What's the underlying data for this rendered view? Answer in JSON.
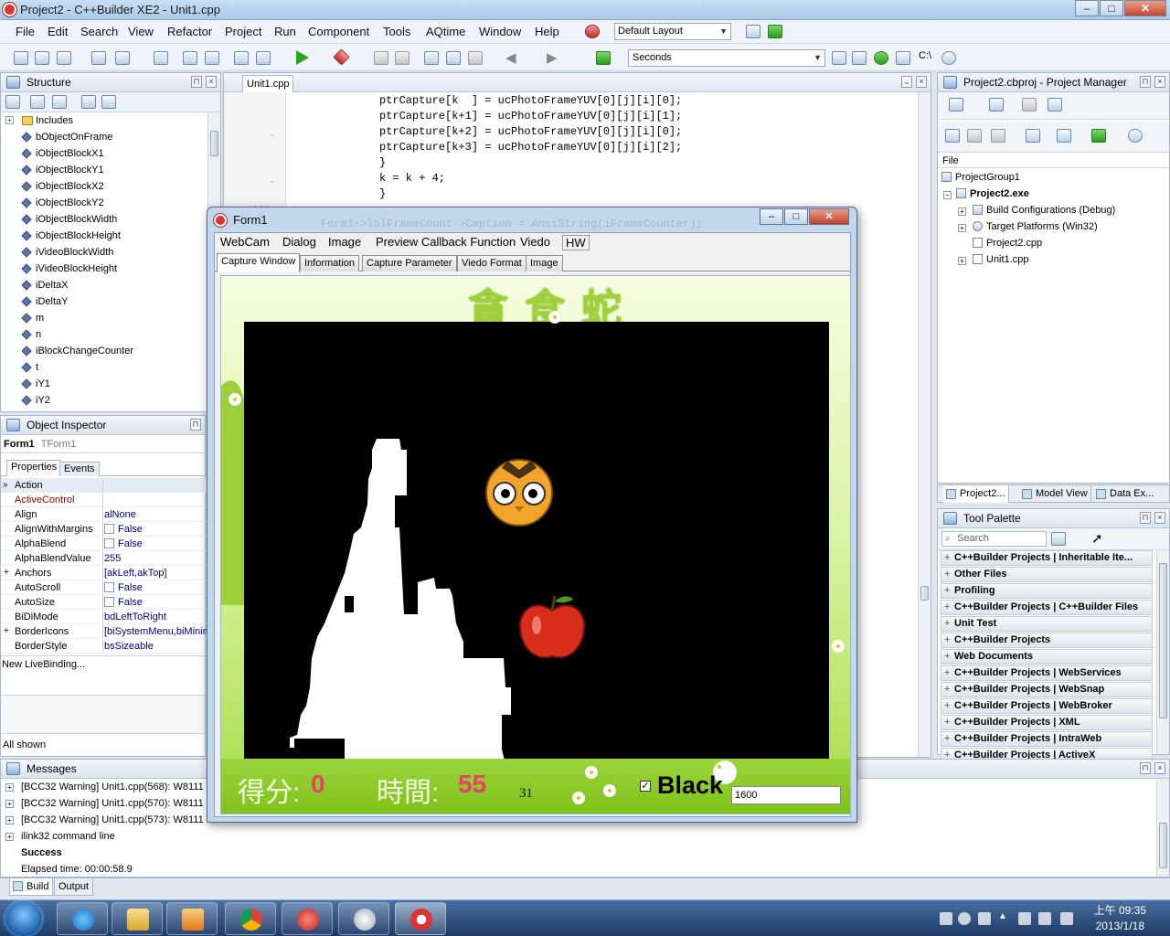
{
  "window": {
    "title": "Project2 - C++Builder XE2 - Unit1.cpp",
    "buttons": {
      "minimize": "–",
      "maximize": "□",
      "close": "✕"
    }
  },
  "menu": [
    "File",
    "Edit",
    "Search",
    "View",
    "Refactor",
    "Project",
    "Run",
    "Component",
    "Tools",
    "AQtime",
    "Window",
    "Help"
  ],
  "layout_select": "Default Layout",
  "toolbar": {
    "seconds_select": "Seconds",
    "path_label": "C:\\"
  },
  "structure": {
    "title": "Structure",
    "folder": "Includes",
    "items": [
      "bObjectOnFrame",
      "iObjectBlockX1",
      "iObjectBlockY1",
      "iObjectBlockX2",
      "iObjectBlockY2",
      "iObjectBlockWidth",
      "iObjectBlockHeight",
      "iVideoBlockWidth",
      "iVideoBlockHeight",
      "iDeltaX",
      "iDeltaY",
      "m",
      "n",
      "iBlockChangeCounter",
      "t",
      "iY1",
      "iY2"
    ]
  },
  "inspector": {
    "title": "Object Inspector",
    "object_name": "Form1",
    "object_type": "TForm1",
    "tabs": [
      "Properties",
      "Events"
    ],
    "properties": [
      {
        "name": "Action",
        "value": ""
      },
      {
        "name": "ActiveControl",
        "value": ""
      },
      {
        "name": "Align",
        "value": "alNone"
      },
      {
        "name": "AlignWithMargins",
        "value": "False"
      },
      {
        "name": "AlphaBlend",
        "value": "False"
      },
      {
        "name": "AlphaBlendValue",
        "value": "255"
      },
      {
        "name": "Anchors",
        "value": "[akLeft,akTop]"
      },
      {
        "name": "AutoScroll",
        "value": "False"
      },
      {
        "name": "AutoSize",
        "value": "False"
      },
      {
        "name": "BiDiMode",
        "value": "bdLeftToRight"
      },
      {
        "name": "BorderIcons",
        "value": "[biSystemMenu,biMinim"
      },
      {
        "name": "BorderStyle",
        "value": "bsSizeable"
      }
    ],
    "livebinding": "New LiveBinding...",
    "status": "All shown"
  },
  "editor": {
    "tab": "Unit1.cpp",
    "line_number": "1820",
    "code": [
      "ptrCapture[k  ] = ucPhotoFrameYUV[0][j][i][0];",
      "ptrCapture[k+1] = ucPhotoFrameYUV[0][j][i][1];",
      "ptrCapture[k+2] = ucPhotoFrameYUV[0][j][i][0];",
      "ptrCapture[k+3] = ucPhotoFrameYUV[0][j][i][2];",
      "}",
      "k = k + 4;",
      "}"
    ],
    "ghost_line": "Form1->lblFrameCount->Caption = AnsiString(iFrameCounter);"
  },
  "project_manager": {
    "title": "Project2.cbproj - Project Manager",
    "file_label": "File",
    "tree": [
      "ProjectGroup1",
      "Project2.exe",
      "Build Configurations (Debug)",
      "Target Platforms (Win32)",
      "Project2.cpp",
      "Unit1.cpp"
    ],
    "tabs": [
      "Project2...",
      "Model View",
      "Data Ex..."
    ]
  },
  "tool_palette": {
    "title": "Tool Palette",
    "search_placeholder": "Search",
    "categories": [
      "C++Builder Projects | Inheritable Ite...",
      "Other Files",
      "Profiling",
      "C++Builder Projects | C++Builder Files",
      "Unit Test",
      "C++Builder Projects",
      "Web Documents",
      "C++Builder Projects | WebServices",
      "C++Builder Projects | WebSnap",
      "C++Builder Projects | WebBroker",
      "C++Builder Projects | XML",
      "C++Builder Projects | IntraWeb",
      "C++Builder Projects | ActiveX"
    ]
  },
  "messages": {
    "title": "Messages",
    "rows": [
      "[BCC32 Warning] Unit1.cpp(568): W8111",
      "[BCC32 Warning] Unit1.cpp(570): W8111",
      "[BCC32 Warning] Unit1.cpp(573): W8111",
      "ilink32 command line",
      "Success",
      "Elapsed time: 00:00:58.9"
    ],
    "tabs": [
      "Build",
      "Output"
    ]
  },
  "form1": {
    "title": "Form1",
    "menu": [
      "WebCam",
      "Dialog",
      "Image",
      "Preview Callback Function",
      "Viedo",
      "HW"
    ],
    "tabs": [
      "Capture Window",
      "Information",
      "Capture Parameter",
      "Viedo Format",
      "Image"
    ],
    "game": {
      "title": "貪食蛇",
      "score_label": "得分:",
      "score": "0",
      "time_label": "時間:",
      "time": "55",
      "frame_count": "31",
      "black_label": "Black",
      "black_checked": "✓",
      "threshold": "1600"
    }
  },
  "taskbar": {
    "clock_time": "上午 09:35",
    "clock_date": "2013/1/18"
  },
  "colors": {
    "accent": "#9ed238",
    "score": "#e8406a",
    "editor_bg": "#ffffff"
  }
}
